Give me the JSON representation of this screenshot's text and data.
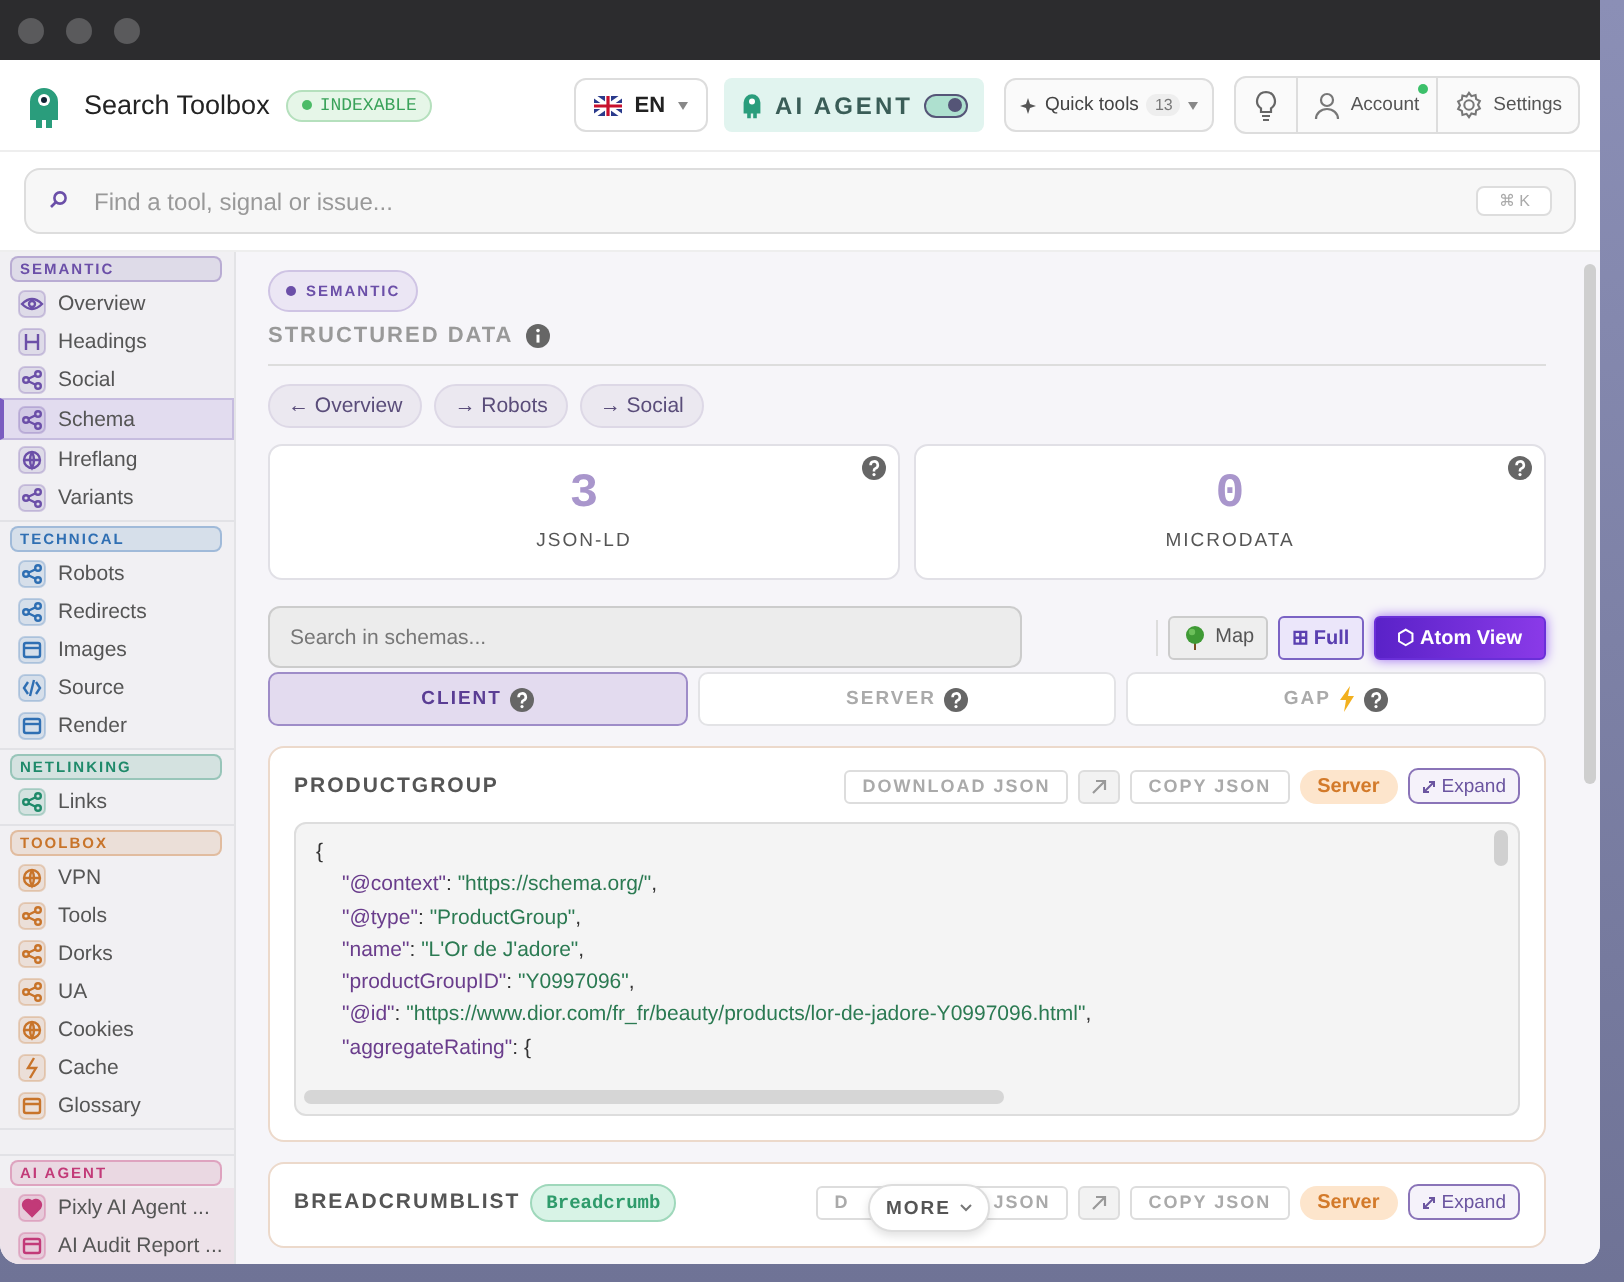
{
  "header": {
    "app_name": "Search Toolbox",
    "status_badge": "INDEXABLE",
    "language": "EN",
    "ai_agent": {
      "label": "AI AGENT",
      "on": true
    },
    "quick_tools": {
      "label": "Quick tools",
      "count": "13"
    },
    "account": {
      "label": "Account",
      "online": true
    },
    "settings": "Settings"
  },
  "search": {
    "placeholder": "Find a tool, signal or issue...",
    "shortcut": "⌘ K"
  },
  "sidebar": {
    "sections": [
      {
        "title": "SEMANTIC",
        "color": "#6b4fa8",
        "items": [
          {
            "label": "Overview",
            "selected": false
          },
          {
            "label": "Headings",
            "selected": false
          },
          {
            "label": "Social",
            "selected": false
          },
          {
            "label": "Schema",
            "selected": true
          },
          {
            "label": "Hreflang",
            "selected": false
          },
          {
            "label": "Variants",
            "selected": false
          }
        ]
      },
      {
        "title": "TECHNICAL",
        "color": "#2f6fb3",
        "items": [
          {
            "label": "Robots",
            "selected": false
          },
          {
            "label": "Redirects",
            "selected": false
          },
          {
            "label": "Images",
            "selected": false
          },
          {
            "label": "Source",
            "selected": false
          },
          {
            "label": "Render",
            "selected": false
          }
        ]
      },
      {
        "title": "NETLINKING",
        "color": "#1f8a6a",
        "items": [
          {
            "label": "Links",
            "selected": false
          }
        ]
      },
      {
        "title": "TOOLBOX",
        "color": "#c8742a",
        "items": [
          {
            "label": "VPN",
            "selected": false
          },
          {
            "label": "Tools",
            "selected": false
          },
          {
            "label": "Dorks",
            "selected": false
          },
          {
            "label": "UA",
            "selected": false
          },
          {
            "label": "Cookies",
            "selected": false
          },
          {
            "label": "Cache",
            "selected": false
          },
          {
            "label": "Glossary",
            "selected": false
          }
        ]
      },
      {
        "title": "AI AGENT",
        "color": "#c23a78",
        "items": [
          {
            "label": "Pixly AI Agent ...",
            "selected": false
          },
          {
            "label": "AI Audit Report ...",
            "selected": false
          }
        ]
      }
    ]
  },
  "main": {
    "category": "SEMANTIC",
    "heading": "STRUCTURED DATA",
    "nav_links": [
      "← Overview",
      "→ Robots",
      "→ Social"
    ],
    "stats": [
      {
        "value": "3",
        "label": "JSON-LD"
      },
      {
        "value": "0",
        "label": "MICRODATA"
      }
    ],
    "schema_search": {
      "placeholder": "Search in schemas..."
    },
    "view_buttons": [
      {
        "label": "Map",
        "kind": "map",
        "selected": false
      },
      {
        "label": "⊞ Full",
        "kind": "toggle",
        "selected": true
      },
      {
        "label": "⬡ Atom View",
        "kind": "primary",
        "selected": true
      }
    ],
    "source_tabs": [
      {
        "label": "CLIENT",
        "kind": "plain",
        "selected": true
      },
      {
        "label": "SERVER",
        "kind": "plain",
        "selected": false
      },
      {
        "label": "GAP",
        "kind": "bolt",
        "selected": false
      }
    ],
    "schemas": [
      {
        "type": "PRODUCTGROUP",
        "download": [
          "DOWNLOAD JSON"
        ],
        "copy": "COPY JSON",
        "source": "Server",
        "expand": "Expand",
        "code": {
          "open": "{",
          "entries": [
            {
              "key": "\"@context\"",
              "sep": ": ",
              "value": "\"https://schema.org/\"",
              "end": ",",
              "kind": "string"
            },
            {
              "key": "\"@type\"",
              "sep": ": ",
              "value": "\"ProductGroup\"",
              "end": ",",
              "kind": "string"
            },
            {
              "key": "\"name\"",
              "sep": ": ",
              "value": "\"L'Or de J'adore\"",
              "end": ",",
              "kind": "string"
            },
            {
              "key": "\"productGroupID\"",
              "sep": ": ",
              "value": "\"Y0997096\"",
              "end": ",",
              "kind": "string"
            },
            {
              "key": "\"@id\"",
              "sep": ": ",
              "value": "\"https://www.dior.com/fr_fr/beauty/products/lor-de-jadore-Y0997096.html\"",
              "end": ",",
              "kind": "string"
            },
            {
              "key": "\"aggregateRating\"",
              "sep": ": ",
              "value": "{",
              "kind": "object"
            }
          ]
        }
      },
      {
        "type": "BREADCRUMBLIST",
        "tag": "Breadcrumb",
        "download": [
          "D",
          "JSON"
        ],
        "copy": "COPY JSON",
        "source": "Server",
        "expand": "Expand"
      }
    ],
    "more": "MORE"
  }
}
